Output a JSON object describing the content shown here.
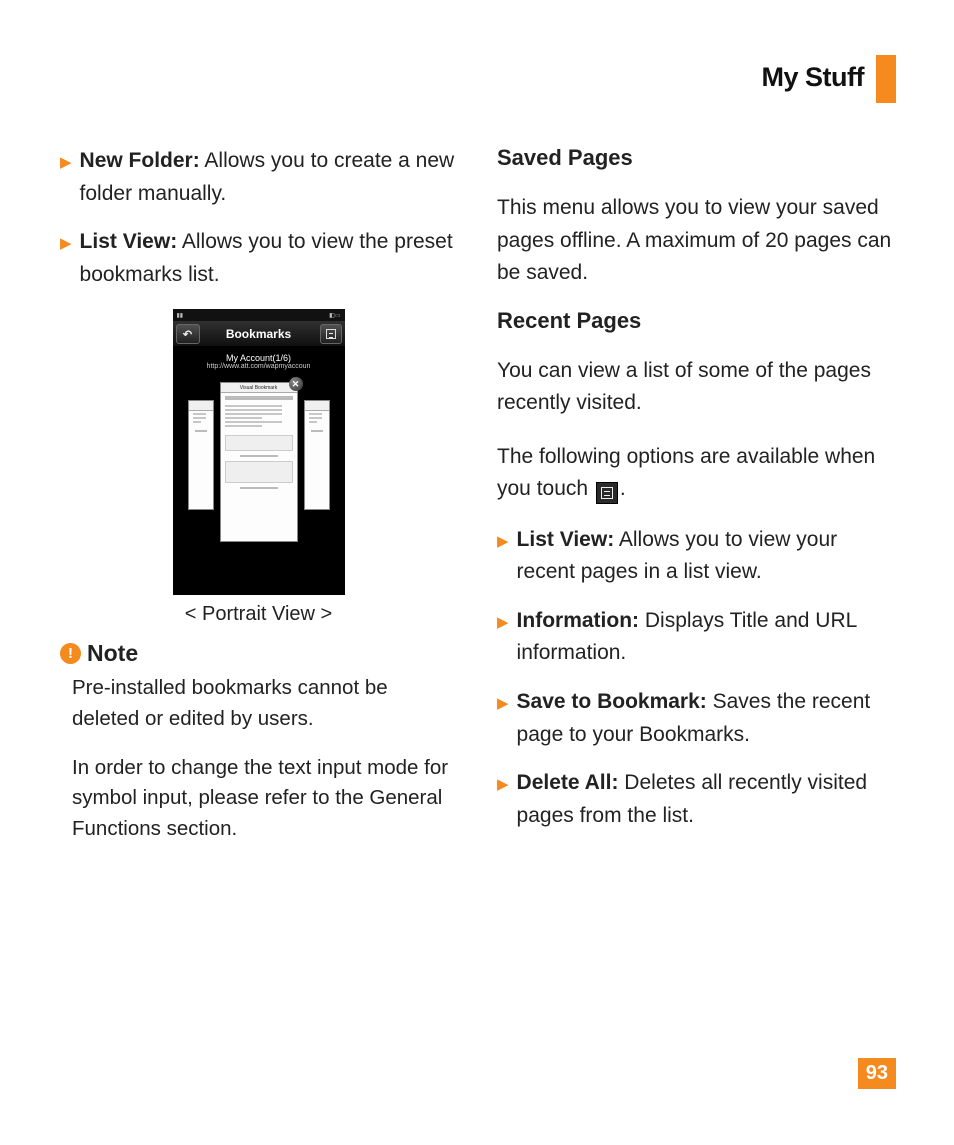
{
  "pageTitle": "My Stuff",
  "pageNumber": "93",
  "left": {
    "bullets": [
      {
        "lead": "New Folder:",
        "rest": " Allows you to create a new folder manually."
      },
      {
        "lead": "List View:",
        "rest": " Allows you to view the preset bookmarks list."
      }
    ],
    "phone": {
      "title": "Bookmarks",
      "account": "My Account(1/6)",
      "url": "http://www.att.com/wapmyaccoun",
      "centerHeader": "Visual Bookmark"
    },
    "caption": "< Portrait View >",
    "noteTitle": "Note",
    "notePara1": "Pre-installed bookmarks cannot be deleted or edited by users.",
    "notePara2": "In order to change the text input mode for symbol input, please refer to the General Functions section."
  },
  "right": {
    "saved": {
      "heading": "Saved Pages",
      "text": "This menu allows you to view your saved pages offline. A maximum of 20 pages can be saved."
    },
    "recent": {
      "heading": "Recent Pages",
      "intro": "You can view a list of some of the pages recently visited.",
      "optionsPrefix": "The following options are available when you touch ",
      "optionsSuffix": ".",
      "bullets": [
        {
          "lead": "List View:",
          "rest": " Allows you to view your recent pages in a list view."
        },
        {
          "lead": "Information:",
          "rest": " Displays Title and URL information."
        },
        {
          "lead": "Save to Bookmark:",
          "rest": " Saves the recent page to your Bookmarks."
        },
        {
          "lead": "Delete All:",
          "rest": " Deletes all recently visited pages from the list."
        }
      ]
    }
  }
}
